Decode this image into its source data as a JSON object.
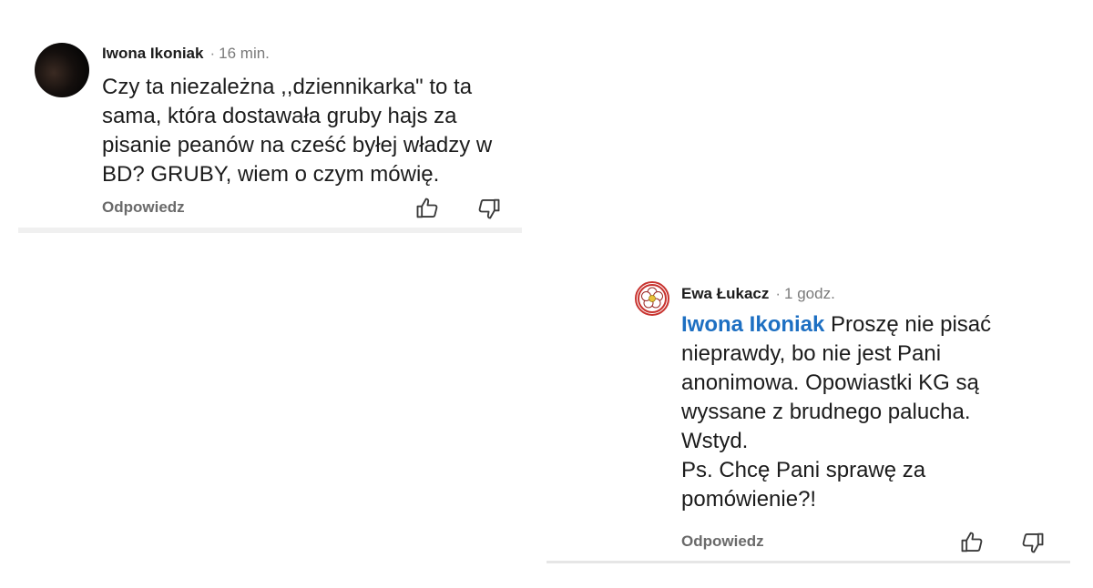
{
  "comments": [
    {
      "author": "Iwona Ikoniak",
      "separator": "·",
      "time": "16 min.",
      "text": "Czy ta niezależna ,,dziennikarka\" to ta\nsama, która dostawała gruby hajs za\npisanie peanów na cześć byłej władzy w\nBD?  GRUBY, wiem o czym mówię.",
      "reply_label": "Odpowiedz",
      "avatar_icon": "profile-photo-avatar"
    },
    {
      "author": "Ewa Łukacz",
      "separator": "·",
      "time": "1 godz.",
      "mention": "Iwona Ikoniak",
      "text": " Proszę nie pisać\nnieprawdy, bo nie jest Pani\nanonimowa. Opowiastki KG są\nwyssane z brudnego palucha.\nWstyd.\nPs. Chcę Pani sprawę za\npomówienie?!",
      "reply_label": "Odpowiedz",
      "avatar_icon": "rose-emblem-avatar"
    }
  ],
  "colors": {
    "mention": "#1d6fc2",
    "text": "#1c1c1c",
    "muted": "#7a7a7a"
  },
  "icons": [
    "thumbs-up-icon",
    "thumbs-down-icon"
  ]
}
